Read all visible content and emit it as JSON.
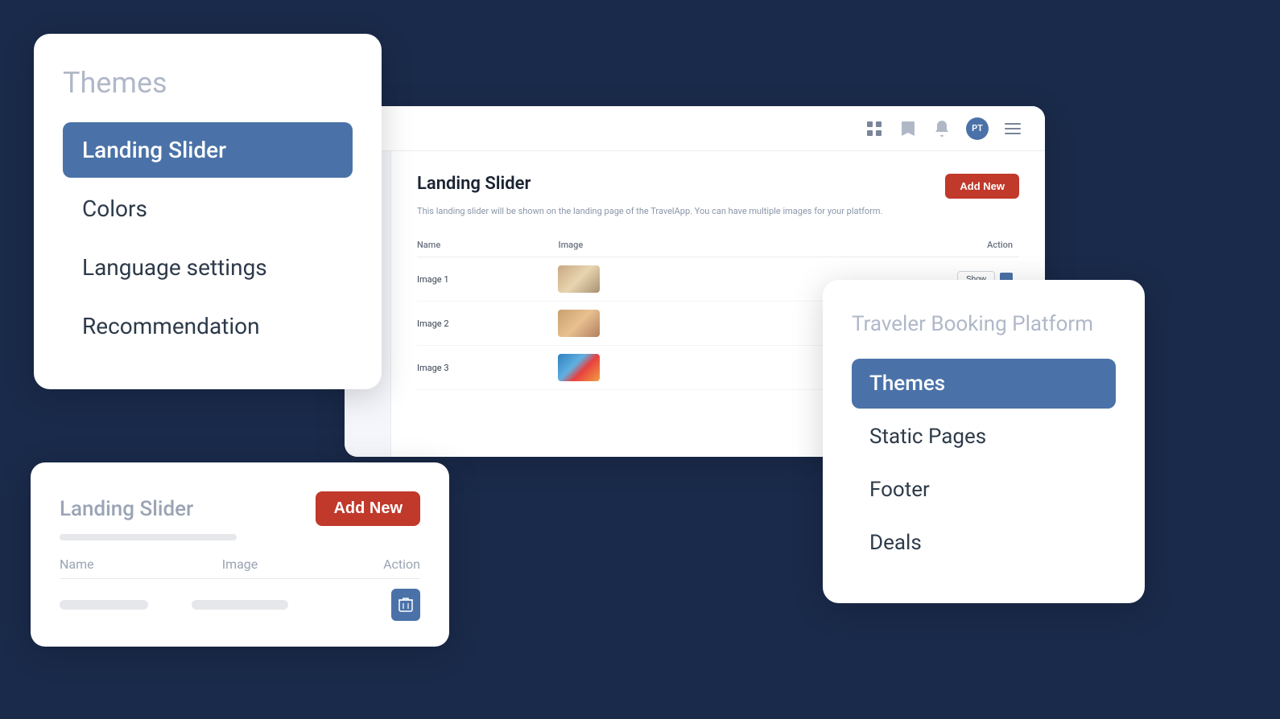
{
  "sidebar": {
    "title": "Themes",
    "items": [
      {
        "label": "Landing Slider",
        "active": true
      },
      {
        "label": "Colors",
        "active": false
      },
      {
        "label": "Language settings",
        "active": false
      },
      {
        "label": "Recommendation",
        "active": false
      }
    ]
  },
  "topbar": {
    "icons": [
      "grid-icon",
      "bookmark-icon",
      "bell-icon",
      "avatar-icon",
      "menu-icon"
    ],
    "avatar_initials": "PT"
  },
  "main_content": {
    "page_title": "Landing Slider",
    "page_subtitle": "This landing slider will be shown on the landing page of the TravelApp. You can have multiple images for your platform.",
    "add_new_label": "Add New",
    "table": {
      "headers": [
        "Name",
        "Image",
        "Action"
      ],
      "rows": [
        {
          "name": "Image 1",
          "image_class": "img-1",
          "action": "Show"
        },
        {
          "name": "Image 2",
          "image_class": "img-2",
          "action": null
        },
        {
          "name": "Image 3",
          "image_class": "img-3",
          "action": null
        }
      ]
    }
  },
  "bottom_card": {
    "title": "Landing Slider",
    "add_new_label": "Add New",
    "table": {
      "col_name": "Name",
      "col_image": "Image",
      "col_action": "Action"
    }
  },
  "right_sidebar": {
    "platform_title": "Traveler Booking Platform",
    "items": [
      {
        "label": "Themes",
        "active": true
      },
      {
        "label": "Static Pages",
        "active": false
      },
      {
        "label": "Footer",
        "active": false
      },
      {
        "label": "Deals",
        "active": false
      }
    ]
  }
}
